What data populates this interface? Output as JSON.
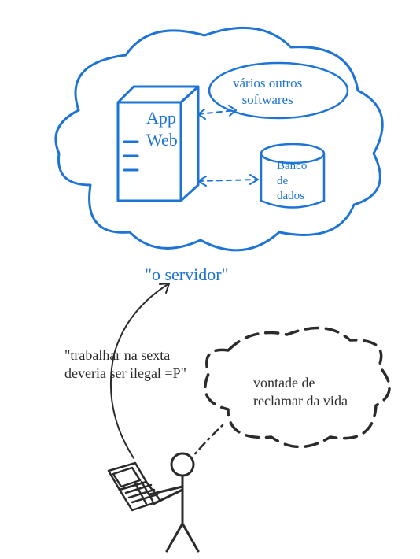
{
  "diagram": {
    "cloud_caption": "\"o servidor\"",
    "server_label": "App\nWeb",
    "other_software_label": "vários outros\nsoftwares",
    "database_label": "Banco\nde\ndados",
    "user_message": "\"trabalhar na sexta\ndeveria ser ilegal =P\"",
    "thought_text": "vontade de\nreclamar da vida",
    "arrow_to_cloud_href": "o servidor",
    "colors": {
      "blue": "#1e74d6",
      "black": "#2b2b2b"
    }
  }
}
